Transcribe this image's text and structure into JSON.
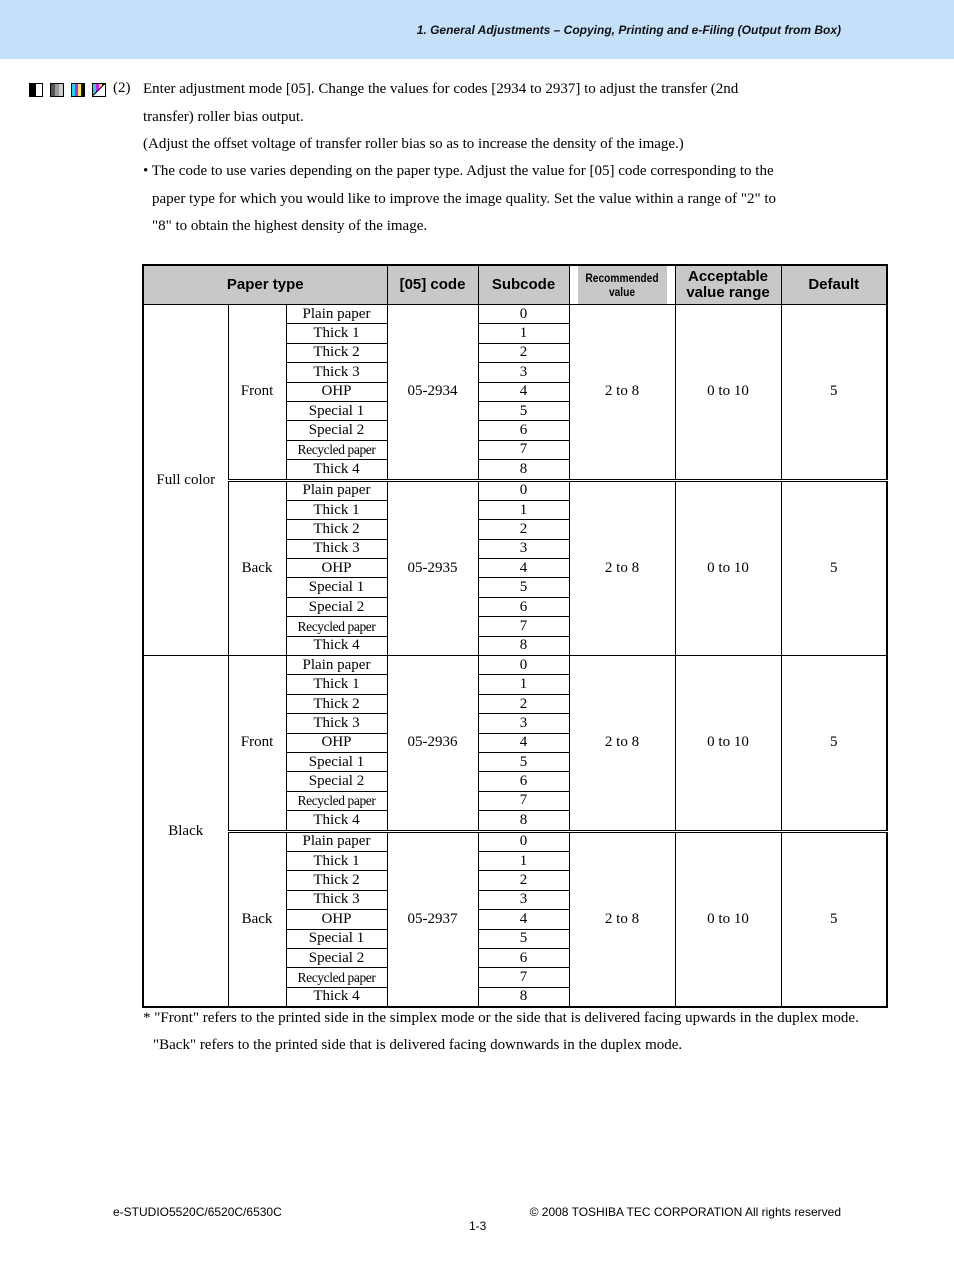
{
  "header": {
    "title": "1. General Adjustments – Copying, Printing and e-Filing (Output from Box)",
    "band_color": "#c5e0fb"
  },
  "mode_icons": [
    {
      "name": "black-white-mode-icon"
    },
    {
      "name": "grayscale-mode-icon"
    },
    {
      "name": "twin-color-mode-icon"
    },
    {
      "name": "full-color-mode-icon"
    }
  ],
  "step": {
    "number": "(2)",
    "line1": "Enter adjustment mode [05].  Change the values for codes [2934 to 2937] to adjust the transfer (2nd",
    "line2": "transfer) roller bias output.",
    "line3": "(Adjust the offset voltage of transfer roller bias so as to increase the density of the image.)",
    "bullet1": "• The code to use varies depending on the paper type.  Adjust the value for [05] code corresponding to the",
    "bullet2": "paper type for which you would like to improve the image quality.  Set the value within a range of \"2\" to",
    "bullet3": "\"8\" to obtain the highest density of the image."
  },
  "table": {
    "headers": {
      "paper_type": "Paper type",
      "code": "[05] code",
      "subcode": "Subcode",
      "recommended_1": "Recommended",
      "recommended_2": "value",
      "acceptable_1": "Acceptable",
      "acceptable_2": "value range",
      "default": "Default"
    },
    "paper_types": [
      "Plain paper",
      "Thick 1",
      "Thick 2",
      "Thick 3",
      "OHP",
      "Special 1",
      "Special 2",
      "Recycled paper",
      "Thick 4"
    ],
    "subcodes": [
      "0",
      "1",
      "2",
      "3",
      "4",
      "5",
      "6",
      "7",
      "8"
    ],
    "groups": [
      {
        "mode": "Full color",
        "sections": [
          {
            "side": "Front",
            "code": "05-2934",
            "recommended": "2 to 8",
            "range": "0 to 10",
            "default": "5"
          },
          {
            "side": "Back",
            "code": "05-2935",
            "recommended": "2 to 8",
            "range": "0 to 10",
            "default": "5"
          }
        ]
      },
      {
        "mode": "Black",
        "sections": [
          {
            "side": "Front",
            "code": "05-2936",
            "recommended": "2 to 8",
            "range": "0 to 10",
            "default": "5"
          },
          {
            "side": "Back",
            "code": "05-2937",
            "recommended": "2 to 8",
            "range": "0 to 10",
            "default": "5"
          }
        ]
      }
    ]
  },
  "notes": {
    "line1": "* \"Front\" refers to the printed side in the simplex mode or the side that is delivered facing upwards in the duplex mode.",
    "line2": "\"Back\" refers to the printed side that is delivered facing downwards in the duplex mode."
  },
  "footer": {
    "model": "e-STUDIO5520C/6520C/6530C",
    "copyright": "© 2008 TOSHIBA TEC CORPORATION All rights reserved",
    "page": "1-3"
  }
}
